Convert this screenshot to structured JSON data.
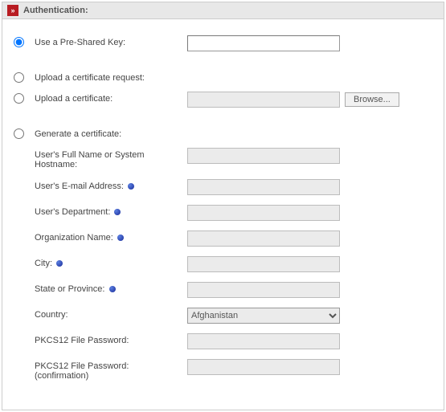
{
  "panel": {
    "title": "Authentication:"
  },
  "auth": {
    "options": {
      "psk": "Use a Pre-Shared Key:",
      "upload_req": "Upload a certificate request:",
      "upload_cert": "Upload a certificate:",
      "generate": "Generate a certificate:"
    },
    "browse_label": "Browse...",
    "psk_value": "",
    "upload_value": ""
  },
  "gen": {
    "fields": {
      "fullname": {
        "label": "User's Full Name or System Hostname:",
        "value": "",
        "info": false
      },
      "email": {
        "label": "User's E-mail Address:",
        "value": "",
        "info": true
      },
      "dept": {
        "label": "User's Department:",
        "value": "",
        "info": true
      },
      "org": {
        "label": "Organization Name:",
        "value": "",
        "info": true
      },
      "city": {
        "label": "City:",
        "value": "",
        "info": true
      },
      "state": {
        "label": "State or Province:",
        "value": "",
        "info": true
      },
      "country": {
        "label": "Country:",
        "value": "Afghanistan",
        "info": false
      },
      "pkcs_pw": {
        "label": "PKCS12 File Password:",
        "value": "",
        "info": false
      },
      "pkcs_pw2": {
        "label": "PKCS12 File Password: (confirmation)",
        "value": "",
        "info": false
      }
    }
  }
}
